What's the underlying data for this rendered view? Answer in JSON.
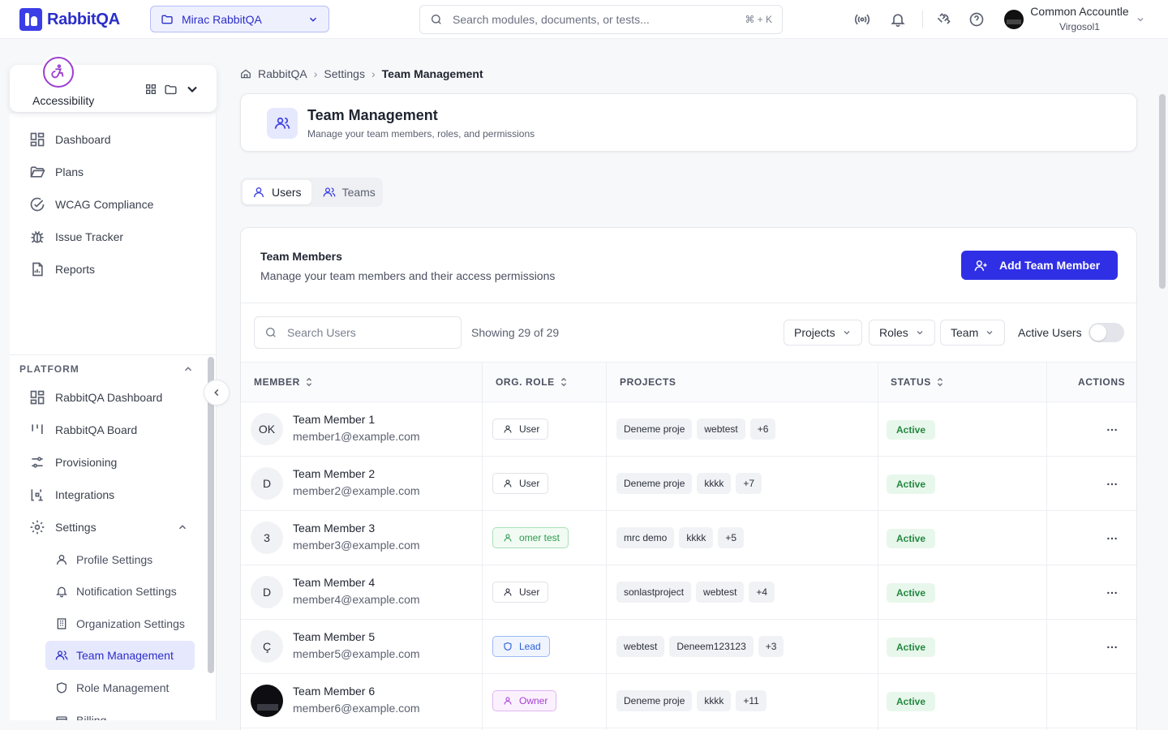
{
  "header": {
    "logo_text": "RabbitQA",
    "project": "Mirac RabbitQA",
    "search_placeholder": "Search modules, documents, or tests...",
    "search_shortcut": "⌘ + K",
    "user_name": "Common Accountle",
    "user_org": "Virgosol1"
  },
  "module": {
    "name": "Accessibility"
  },
  "sidebar": {
    "module_nav": [
      "Dashboard",
      "Plans",
      "WCAG Compliance",
      "Issue Tracker",
      "Reports"
    ],
    "platform_label": "PLATFORM",
    "platform_nav": [
      "RabbitQA Dashboard",
      "RabbitQA Board",
      "Provisioning",
      "Integrations",
      "Settings"
    ],
    "settings_sub": [
      "Profile Settings",
      "Notification Settings",
      "Organization Settings",
      "Team Management",
      "Role Management",
      "Billing"
    ]
  },
  "breadcrumb": [
    "RabbitQA",
    "Settings",
    "Team Management"
  ],
  "page": {
    "title": "Team Management",
    "subtitle": "Manage your team members, roles, and permissions"
  },
  "tabs": [
    "Users",
    "Teams"
  ],
  "members": {
    "title": "Team Members",
    "subtitle": "Manage your team members and their access permissions",
    "add_button": "Add Team Member",
    "search_placeholder": "Search Users",
    "showing": "Showing 29 of 29",
    "filters": [
      "Projects",
      "Roles",
      "Team"
    ],
    "active_toggle_label": "Active Users",
    "columns": [
      "MEMBER",
      "ORG. ROLE",
      "PROJECTS",
      "STATUS",
      "ACTIONS"
    ],
    "rows": [
      {
        "initials": "OK",
        "name": "Team Member 1",
        "email": "member1@example.com",
        "role": "User",
        "projects": [
          "Deneme proje",
          "webtest",
          "+6"
        ],
        "status": "Active"
      },
      {
        "initials": "D",
        "name": "Team Member 2",
        "email": "member2@example.com",
        "role": "User",
        "projects": [
          "Deneme proje",
          "kkkk",
          "+7"
        ],
        "status": "Active"
      },
      {
        "initials": "3",
        "name": "Team Member 3",
        "email": "member3@example.com",
        "role": "omer test",
        "projects": [
          "mrc demo",
          "kkkk",
          "+5"
        ],
        "status": "Active"
      },
      {
        "initials": "D",
        "name": "Team Member 4",
        "email": "member4@example.com",
        "role": "User",
        "projects": [
          "sonlastproject",
          "webtest",
          "+4"
        ],
        "status": "Active"
      },
      {
        "initials": "Ç",
        "name": "Team Member 5",
        "email": "member5@example.com",
        "role": "Lead",
        "projects": [
          "webtest",
          "Deneem123123",
          "+3"
        ],
        "status": "Active"
      },
      {
        "initials": "",
        "name": "Team Member 6",
        "email": "member6@example.com",
        "role": "Owner",
        "projects": [
          "Deneme proje",
          "kkkk",
          "+11"
        ],
        "status": "Active"
      }
    ]
  },
  "colors": {
    "accent": "#2f2fe6",
    "active_green": "#23883f",
    "module_purple": "#9b3fd1"
  }
}
